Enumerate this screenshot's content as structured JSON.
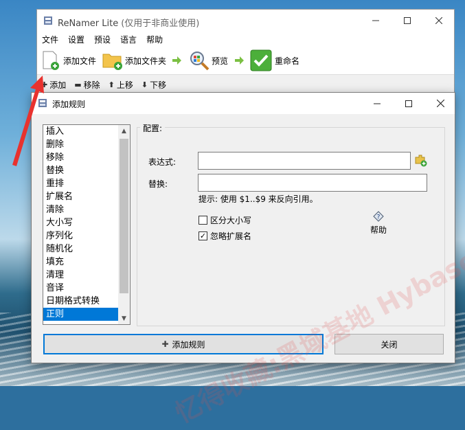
{
  "main_window": {
    "title": "ReNamer Lite",
    "subtitle": "(仅用于非商业使用)",
    "menu": [
      "文件",
      "设置",
      "预设",
      "语言",
      "帮助"
    ],
    "toolbar": {
      "add_files": "添加文件",
      "add_folder": "添加文件夹",
      "preview": "预览",
      "rename": "重命名"
    },
    "rules_toolbar": {
      "add": "添加",
      "remove": "移除",
      "move_up": "上移",
      "move_down": "下移"
    }
  },
  "dialog": {
    "title": "添加规则",
    "rules": [
      "插入",
      "删除",
      "移除",
      "替换",
      "重排",
      "扩展名",
      "清除",
      "大小写",
      "序列化",
      "随机化",
      "填充",
      "清理",
      "音译",
      "日期格式转换",
      "正则"
    ],
    "selected_rule": "正则",
    "config_label": "配置:",
    "expression_label": "表达式:",
    "expression_value": "",
    "replace_label": "替换:",
    "replace_value": "",
    "hint": "提示: 使用 $1..$9 来反向引用。",
    "case_sensitive_label": "区分大小写",
    "case_sensitive_checked": false,
    "ignore_ext_label": "忽略扩展名",
    "ignore_ext_checked": true,
    "help_label": "帮助",
    "add_rule_button": "添加规则",
    "close_button": "关闭"
  },
  "watermark": "忆得收藏:黑域基地  Hybase.com",
  "colors": {
    "accent": "#0078d7",
    "arrow": "#e8322e"
  }
}
